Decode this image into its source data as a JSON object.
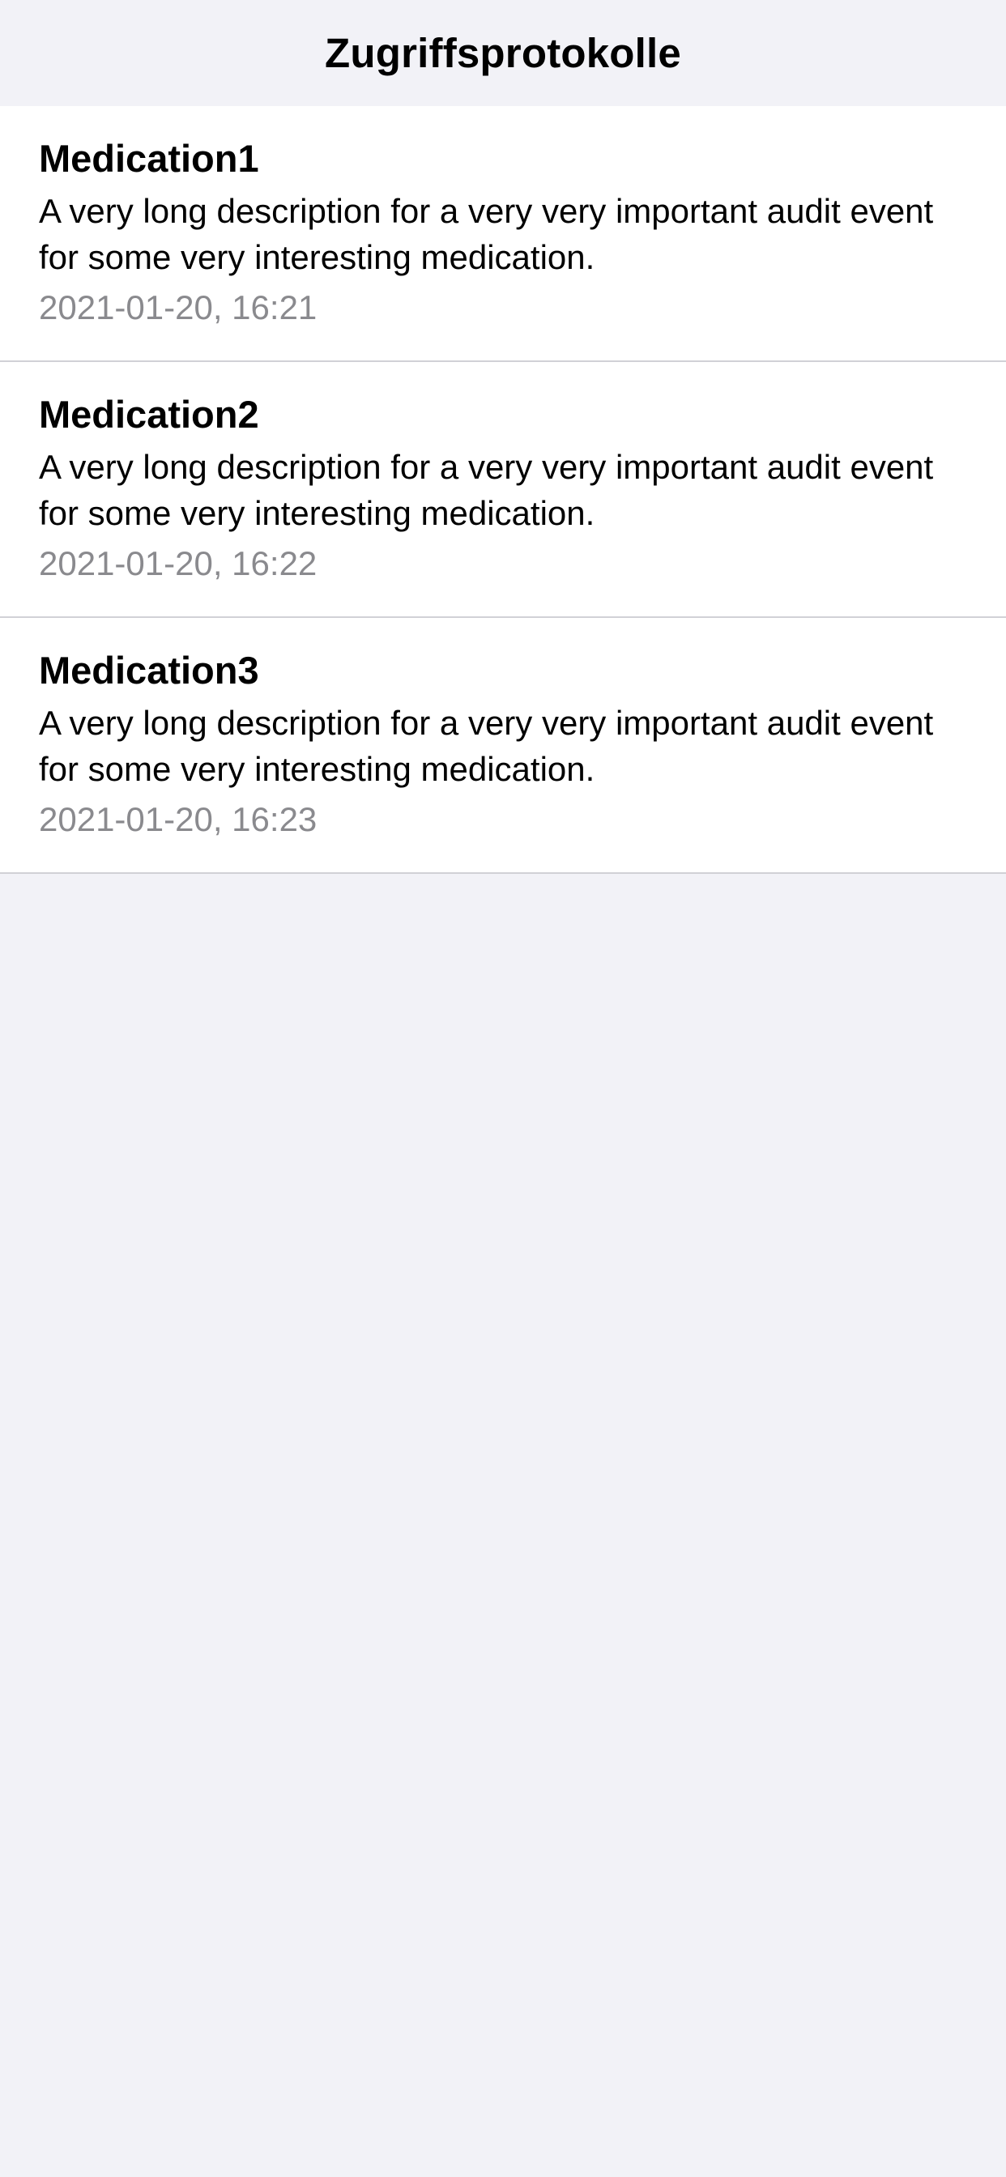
{
  "nav": {
    "title": "Zugriffsprotokolle"
  },
  "entries": [
    {
      "title": "Medication1",
      "description": "A very long description for a very very important audit event for some very interesting medication.",
      "timestamp": "2021-01-20, 16:21"
    },
    {
      "title": "Medication2",
      "description": "A very long description for a very very important audit event for some very interesting medication.",
      "timestamp": "2021-01-20, 16:22"
    },
    {
      "title": "Medication3",
      "description": "A very long description for a very very important audit event for some very interesting medication.",
      "timestamp": "2021-01-20, 16:23"
    }
  ],
  "colors": {
    "background": "#f2f2f7",
    "cell": "#ffffff",
    "secondary_text": "#8a8a8e",
    "separator": "#d1d1d6"
  }
}
